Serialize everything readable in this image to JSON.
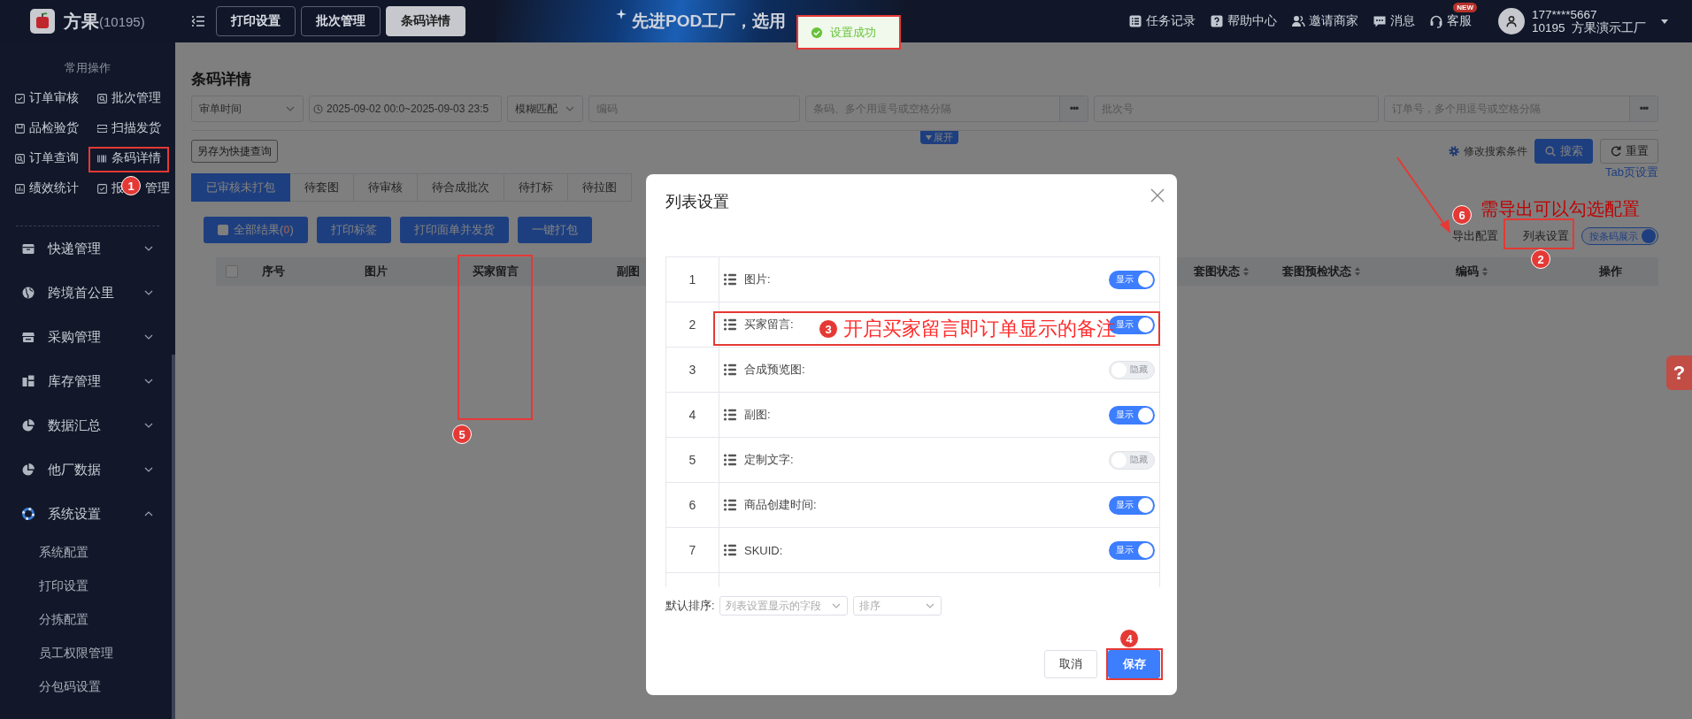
{
  "top_bar": {
    "logo": "方果",
    "account_id": "(10195)",
    "tabs": [
      {
        "label": "打印设置",
        "selected": false
      },
      {
        "label": "批次管理",
        "selected": false
      },
      {
        "label": "条码详情",
        "selected": true
      }
    ],
    "banner": "先进POD工厂，选用",
    "actions": [
      {
        "kind": "tasks",
        "label": "任务记录"
      },
      {
        "kind": "help",
        "label": "帮助中心"
      },
      {
        "kind": "invite",
        "label": "邀请商家"
      },
      {
        "kind": "message",
        "label": "消息"
      },
      {
        "kind": "service",
        "label": "客服",
        "badge": "NEW"
      }
    ],
    "user": {
      "phone": "177****5667",
      "company": "10195  方果演示工厂"
    }
  },
  "toast": {
    "text": "设置成功"
  },
  "sidebar": {
    "section_title": "常用操作",
    "quick_actions": [
      {
        "kind": "check",
        "label": "订单审核"
      },
      {
        "kind": "search-doc",
        "label": "批次管理"
      },
      {
        "kind": "box",
        "label": "品检验货"
      },
      {
        "kind": "scan",
        "label": "扫描发货"
      },
      {
        "kind": "search-doc",
        "label": "订单查询"
      },
      {
        "kind": "barcode",
        "label": "条码详情"
      },
      {
        "kind": "chart",
        "label": "绩效统计"
      },
      {
        "kind": "check",
        "label": "报",
        "label_tail": "管理"
      }
    ],
    "menu": [
      {
        "kind": "package",
        "label": "快递管理",
        "expanded": false
      },
      {
        "kind": "globe",
        "label": "跨境首公里",
        "expanded": false
      },
      {
        "kind": "store",
        "label": "采购管理",
        "expanded": false
      },
      {
        "kind": "blocks",
        "label": "库存管理",
        "expanded": false
      },
      {
        "kind": "pie",
        "label": "数据汇总",
        "expanded": false
      },
      {
        "kind": "pie",
        "label": "他厂数据",
        "expanded": false
      },
      {
        "kind": "lifebuoy",
        "label": "系统设置",
        "expanded": true,
        "children": [
          {
            "label": "系统配置"
          },
          {
            "label": "打印设置"
          },
          {
            "label": "分拣配置"
          },
          {
            "label": "员工权限管理"
          },
          {
            "label": "分包码设置"
          }
        ]
      }
    ]
  },
  "page": {
    "title": "条码详情",
    "filters": [
      {
        "kind": "select",
        "value": "审单时间"
      },
      {
        "kind": "date_range",
        "value": "2025-09-02 00:0~2025-09-03 23:5"
      },
      {
        "kind": "select",
        "value": "模糊匹配"
      },
      {
        "kind": "input",
        "placeholder": "编码"
      },
      {
        "kind": "input_more",
        "placeholder": "条码、多个用逗号或空格分隔",
        "more": "•••"
      },
      {
        "kind": "input",
        "placeholder": "批次号"
      },
      {
        "kind": "input_more",
        "placeholder": "订单号，多个用逗号或空格分隔",
        "more": "•••"
      }
    ],
    "save_query": "另存为快捷查询",
    "expand": "展开",
    "edit_conditions": "修改搜索条件",
    "search": "搜索",
    "reset": "重置",
    "tabs": [
      {
        "label": "已审核未打包",
        "selected": true
      },
      {
        "label": "待套图",
        "selected": false
      },
      {
        "label": "待审核",
        "selected": false
      },
      {
        "label": "待合成批次",
        "selected": false
      },
      {
        "label": "待打标",
        "selected": false
      },
      {
        "label": "待拉图",
        "selected": false
      }
    ],
    "tab_settings": "Tab页设置",
    "actions": [
      {
        "kind": "all",
        "label": "全部结果(",
        "count": "0",
        "suffix": ")",
        "checked": false
      },
      {
        "kind": "plain",
        "label": "打印标签"
      },
      {
        "kind": "plain",
        "label": "打印面单并发货"
      },
      {
        "kind": "plain",
        "label": "一键打包"
      }
    ],
    "export_config": "导出配置",
    "list_settings": "列表设置",
    "barcode_view": {
      "label": "按条码展示",
      "on": true
    },
    "table": {
      "select_all_checked": false,
      "columns": [
        {
          "label": "序号",
          "sortable": false
        },
        {
          "label": "图片",
          "sortable": false
        },
        {
          "label": "买家留言",
          "sortable": false
        },
        {
          "label": "副图",
          "sortable": false
        },
        {
          "label": "套图状态",
          "sortable": true
        },
        {
          "label": "套图预检状态",
          "sortable": true
        },
        {
          "label": "编码",
          "sortable": true
        },
        {
          "label": "操作",
          "sortable": false
        }
      ]
    },
    "help_tab": "?"
  },
  "modal": {
    "title": "列表设置",
    "rows": [
      {
        "index": "1",
        "label": "图片:",
        "on": true,
        "toggle_text": "显示"
      },
      {
        "index": "2",
        "label": "买家留言:",
        "on": true,
        "toggle_text": "显示"
      },
      {
        "index": "3",
        "label": "合成预览图:",
        "on": false,
        "toggle_text": "隐藏"
      },
      {
        "index": "4",
        "label": "副图:",
        "on": true,
        "toggle_text": "显示"
      },
      {
        "index": "5",
        "label": "定制文字:",
        "on": false,
        "toggle_text": "隐藏"
      },
      {
        "index": "6",
        "label": "商品创建时间:",
        "on": true,
        "toggle_text": "显示"
      },
      {
        "index": "7",
        "label": "SKUID:",
        "on": true,
        "toggle_text": "显示"
      }
    ],
    "sort_label": "默认排序:",
    "sort_field_placeholder": "列表设置显示的字段",
    "sort_order_placeholder": "排序",
    "cancel": "取消",
    "save": "保存"
  },
  "annotations": {
    "markers": [
      "1",
      "2",
      "3",
      "4",
      "5",
      "6"
    ],
    "notes": [
      "开启买家留言即订单显示的备注",
      "需导出可以勾选配置"
    ]
  }
}
